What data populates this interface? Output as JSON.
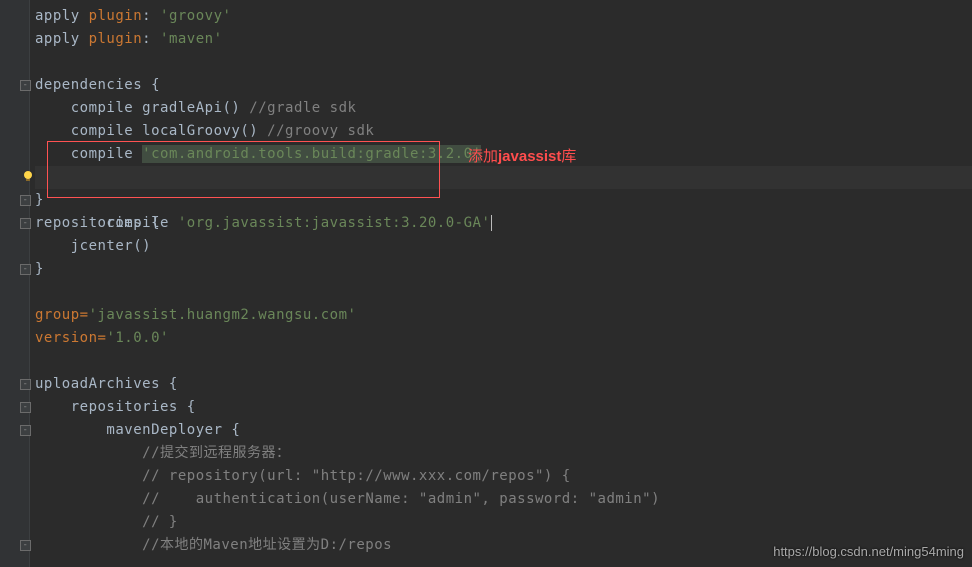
{
  "code": {
    "l1a": "apply ",
    "l1b": "plugin",
    "l1c": ": ",
    "l1d": "'groovy'",
    "l2a": "apply ",
    "l2b": "plugin",
    "l2c": ": ",
    "l2d": "'maven'",
    "l3": "",
    "l4a": "dependencies {",
    "l5a": "    compile gradleApi() ",
    "l5b": "//gradle sdk",
    "l6a": "    compile localGroovy() ",
    "l6b": "//groovy sdk",
    "l7a": "    compile ",
    "l7b": "'com.android.tools.build:gradle:3.2.0'",
    "l8a": "    compile ",
    "l8b": "'org.javassist:javassist:3.20.0-GA'",
    "l9": "}",
    "l10": "repositories {",
    "l11": "    jcenter()",
    "l12": "}",
    "l13": "",
    "l14a": "group=",
    "l14b": "'javassist.huangm2.wangsu.com'",
    "l15a": "version=",
    "l15b": "'1.0.0'",
    "l16": "",
    "l17": "uploadArchives {",
    "l18": "    repositories {",
    "l19": "        mavenDeployer {",
    "l20": "            //提交到远程服务器：",
    "l21": "            // repository(url: \"http://www.xxx.com/repos\") {",
    "l22": "            //    authentication(userName: \"admin\", password: \"admin\")",
    "l23": "            // }",
    "l24": "            //本地的Maven地址设置为D:/repos"
  },
  "annotation": {
    "prefix": "添加",
    "bold": "javassist",
    "suffix": "库"
  },
  "watermark": "https://blog.csdn.net/ming54ming"
}
